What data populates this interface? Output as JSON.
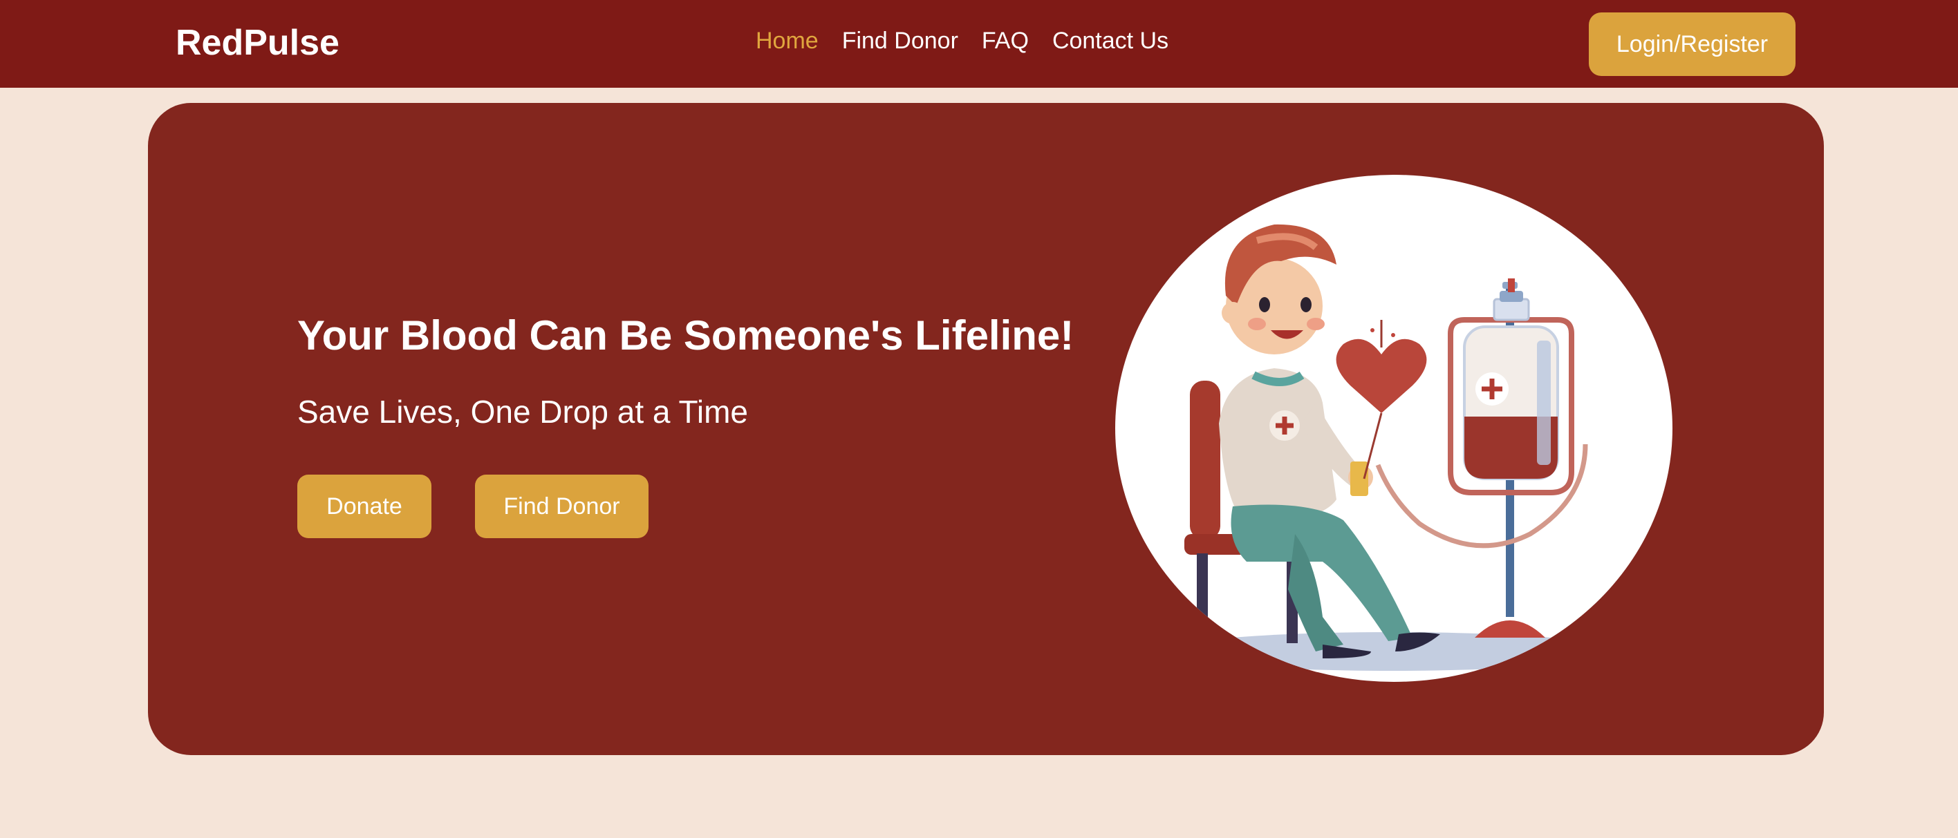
{
  "navbar": {
    "brand": "RedPulse",
    "links": [
      {
        "label": "Home",
        "active": true
      },
      {
        "label": "Find Donor",
        "active": false
      },
      {
        "label": "FAQ",
        "active": false
      },
      {
        "label": "Contact Us",
        "active": false
      }
    ],
    "login_label": "Login/Register"
  },
  "hero": {
    "title": "Your Blood Can Be Someone's Lifeline!",
    "subtitle": "Save Lives, One Drop at a Time",
    "donate_label": "Donate",
    "find_donor_label": "Find Donor",
    "illustration": "blood-donor-illustration"
  },
  "colors": {
    "nav_bg": "#7f1a16",
    "page_bg": "#f5e4d8",
    "hero_bg": "#83261e",
    "accent": "#dba33d",
    "active_link": "#e0a63e"
  }
}
